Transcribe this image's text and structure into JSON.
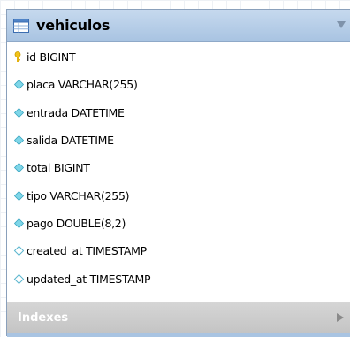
{
  "table": {
    "name": "vehiculos",
    "icon": "table-icon",
    "header_color": "#b6cde7",
    "columns": [
      {
        "text": "id BIGINT",
        "icon": "primary-key-icon"
      },
      {
        "text": "placa VARCHAR(255)",
        "icon": "column-filled-diamond-icon"
      },
      {
        "text": "entrada DATETIME",
        "icon": "column-filled-diamond-icon"
      },
      {
        "text": "salida DATETIME",
        "icon": "column-filled-diamond-icon"
      },
      {
        "text": "total BIGINT",
        "icon": "column-filled-diamond-icon"
      },
      {
        "text": "tipo VARCHAR(255)",
        "icon": "column-filled-diamond-icon"
      },
      {
        "text": "pago DOUBLE(8,2)",
        "icon": "column-filled-diamond-icon"
      },
      {
        "text": "created_at TIMESTAMP",
        "icon": "column-hollow-diamond-icon"
      },
      {
        "text": "updated_at TIMESTAMP",
        "icon": "column-hollow-diamond-icon"
      }
    ],
    "indexes_label": "Indexes"
  }
}
